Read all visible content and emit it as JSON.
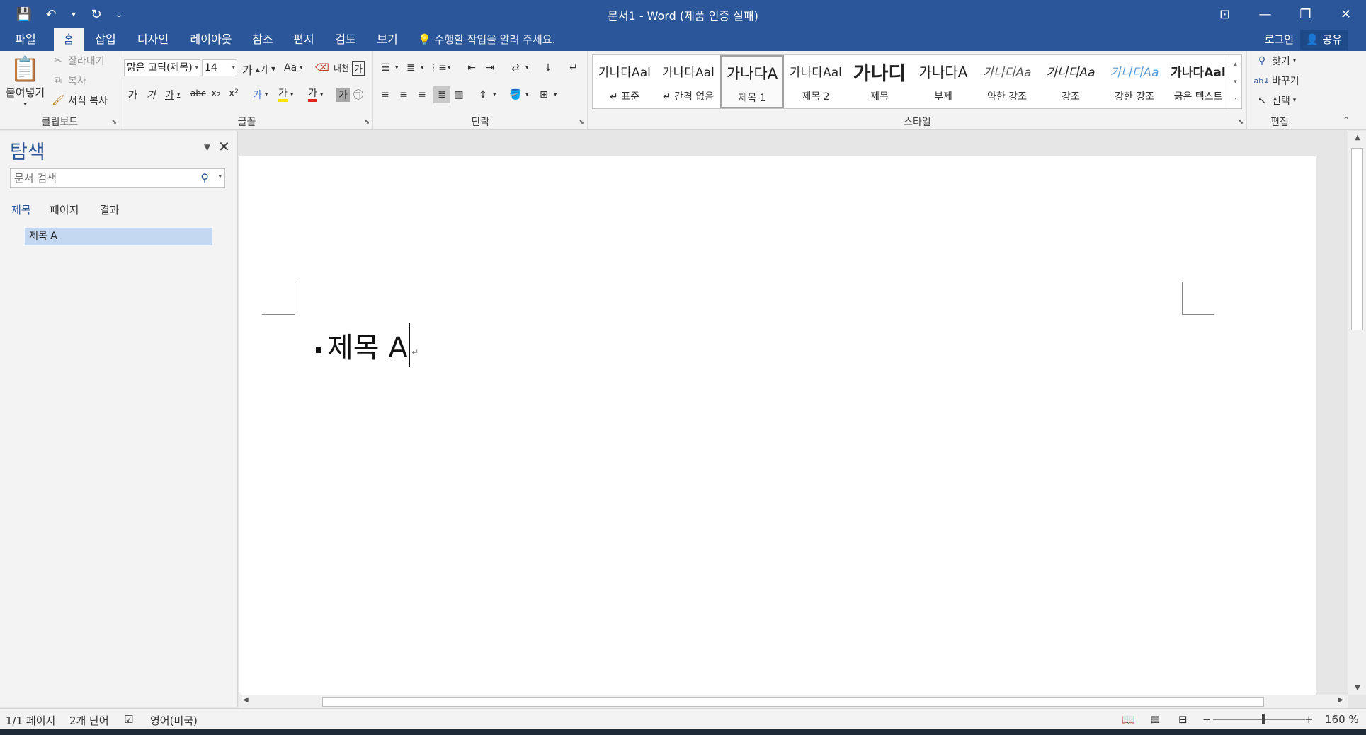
{
  "window": {
    "title": "문서1 - Word (제품 인증 실패)",
    "accent": "#2b579a"
  },
  "qat": {
    "icons": [
      "save-icon",
      "undo-icon",
      "redo-icon",
      "customize-icon"
    ]
  },
  "tabs": {
    "items": [
      "파일",
      "홈",
      "삽입",
      "디자인",
      "레이아웃",
      "참조",
      "편지",
      "검토",
      "보기"
    ],
    "active": "홈",
    "tell_me": "수행할 작업을 알려 주세요.",
    "login": "로그인",
    "share": "공유"
  },
  "ribbon": {
    "clipboard": {
      "label": "클립보드",
      "paste": "붙여넣기",
      "cut": "잘라내기",
      "copy": "복사",
      "format_painter": "서식 복사"
    },
    "font": {
      "label": "글꼴",
      "font_name": "맑은 고딕(제목)",
      "font_size": "14",
      "grow": "가",
      "shrink": "가",
      "case": "Aa",
      "phonetic": "내천",
      "enclose": "가",
      "bold": "가",
      "italic": "가",
      "underline": "가",
      "strike": "abc",
      "subscript": "x₂",
      "superscript": "x²",
      "text_effect": "가",
      "highlight": "가",
      "font_color": "가",
      "char_shading": "가",
      "enclose_char": "㉠",
      "highlight_color": "#ffe400",
      "font_color_value": "#e0241b"
    },
    "paragraph": {
      "label": "단락"
    },
    "styles": {
      "label": "스타일",
      "items": [
        {
          "preview": "가나다Aal",
          "name": "↵ 표준"
        },
        {
          "preview": "가나다Aal",
          "name": "↵ 간격 없음"
        },
        {
          "preview": "가나다A",
          "name": "제목 1"
        },
        {
          "preview": "가나다Aal",
          "name": "제목 2"
        },
        {
          "preview": "가나디",
          "name": "제목"
        },
        {
          "preview": "가나다A",
          "name": "부제"
        },
        {
          "preview": "가나다Aa",
          "name": "약한 강조"
        },
        {
          "preview": "가나다Aa",
          "name": "강조"
        },
        {
          "preview": "가나다Aa",
          "name": "강한 강조"
        },
        {
          "preview": "가나다Aal",
          "name": "굵은 텍스트"
        }
      ],
      "selected_index": 2
    },
    "editing": {
      "label": "편집",
      "find": "찾기",
      "replace": "바꾸기",
      "select": "선택"
    }
  },
  "nav": {
    "title": "탐색",
    "search_placeholder": "문서 검색",
    "tabs": [
      "제목",
      "페이지",
      "결과"
    ],
    "active_tab": "제목",
    "headings": [
      "제목 A"
    ]
  },
  "document": {
    "text": "제목 A"
  },
  "status": {
    "page": "1/1 페이지",
    "words": "2개 단어",
    "language": "영어(미국)",
    "zoom": "160 %",
    "zoom_minus": "−",
    "zoom_plus": "+"
  }
}
